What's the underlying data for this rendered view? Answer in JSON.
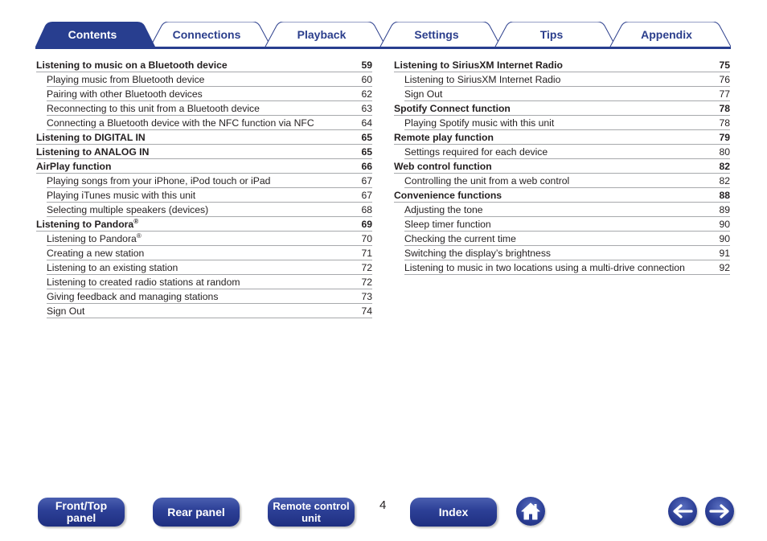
{
  "tabs": [
    {
      "label": "Contents",
      "active": true
    },
    {
      "label": "Connections",
      "active": false
    },
    {
      "label": "Playback",
      "active": false
    },
    {
      "label": "Settings",
      "active": false
    },
    {
      "label": "Tips",
      "active": false
    },
    {
      "label": "Appendix",
      "active": false
    }
  ],
  "colors": {
    "brand_blue": "#283e8f",
    "tab_text": "#2b3e8c",
    "rule": "#a7a9ac"
  },
  "toc_left": [
    {
      "title": "Listening to music on a Bluetooth device",
      "page": "59",
      "level": "main"
    },
    {
      "title": "Playing music from Bluetooth device",
      "page": "60",
      "level": "sub"
    },
    {
      "title": "Pairing with other Bluetooth devices",
      "page": "62",
      "level": "sub"
    },
    {
      "title": "Reconnecting to this unit from a Bluetooth device",
      "page": "63",
      "level": "sub"
    },
    {
      "title": "Connecting a Bluetooth device with the NFC function via NFC",
      "page": "64",
      "level": "sub"
    },
    {
      "title": "Listening to DIGITAL IN",
      "page": "65",
      "level": "main"
    },
    {
      "title": "Listening to ANALOG IN",
      "page": "65",
      "level": "main"
    },
    {
      "title": "AirPlay function",
      "page": "66",
      "level": "main"
    },
    {
      "title": "Playing songs from your iPhone, iPod touch or iPad",
      "page": "67",
      "level": "sub"
    },
    {
      "title": "Playing iTunes music with this unit",
      "page": "67",
      "level": "sub"
    },
    {
      "title": "Selecting multiple speakers (devices)",
      "page": "68",
      "level": "sub"
    },
    {
      "title": "Listening to Pandora",
      "sup": "®",
      "page": "69",
      "level": "main"
    },
    {
      "title": "Listening to Pandora",
      "sup": "®",
      "page": "70",
      "level": "sub"
    },
    {
      "title": "Creating a new station",
      "page": "71",
      "level": "sub"
    },
    {
      "title": "Listening to an existing station",
      "page": "72",
      "level": "sub"
    },
    {
      "title": "Listening to created radio stations at random",
      "page": "72",
      "level": "sub"
    },
    {
      "title": "Giving feedback and managing stations",
      "page": "73",
      "level": "sub"
    },
    {
      "title": "Sign Out",
      "page": "74",
      "level": "sub"
    }
  ],
  "toc_right": [
    {
      "title": "Listening to SiriusXM Internet Radio",
      "page": "75",
      "level": "main"
    },
    {
      "title": "Listening to SiriusXM Internet Radio",
      "page": "76",
      "level": "sub"
    },
    {
      "title": "Sign Out",
      "page": "77",
      "level": "sub"
    },
    {
      "title": "Spotify Connect function",
      "page": "78",
      "level": "main"
    },
    {
      "title": "Playing Spotify music with this unit",
      "page": "78",
      "level": "sub"
    },
    {
      "title": "Remote play function",
      "page": "79",
      "level": "main"
    },
    {
      "title": "Settings required for each device",
      "page": "80",
      "level": "sub"
    },
    {
      "title": "Web control function",
      "page": "82",
      "level": "main"
    },
    {
      "title": "Controlling the unit from a web control",
      "page": "82",
      "level": "sub"
    },
    {
      "title": "Convenience functions",
      "page": "88",
      "level": "main"
    },
    {
      "title": "Adjusting the tone",
      "page": "89",
      "level": "sub"
    },
    {
      "title": "Sleep timer function",
      "page": "90",
      "level": "sub"
    },
    {
      "title": "Checking the current time",
      "page": "90",
      "level": "sub"
    },
    {
      "title": "Switching the display’s brightness",
      "page": "91",
      "level": "sub"
    },
    {
      "title": "Listening to music in two locations using a multi-drive connection",
      "page": "92",
      "level": "sub"
    }
  ],
  "footer": {
    "front_top_panel": {
      "line1": "Front/Top",
      "line2": "panel"
    },
    "rear_panel": "Rear panel",
    "remote_control": {
      "line1": "Remote control",
      "line2": "unit"
    },
    "page_number": "4",
    "index": "Index",
    "icons": {
      "home": "home-icon",
      "back": "arrow-left-icon",
      "forward": "arrow-right-icon"
    }
  }
}
